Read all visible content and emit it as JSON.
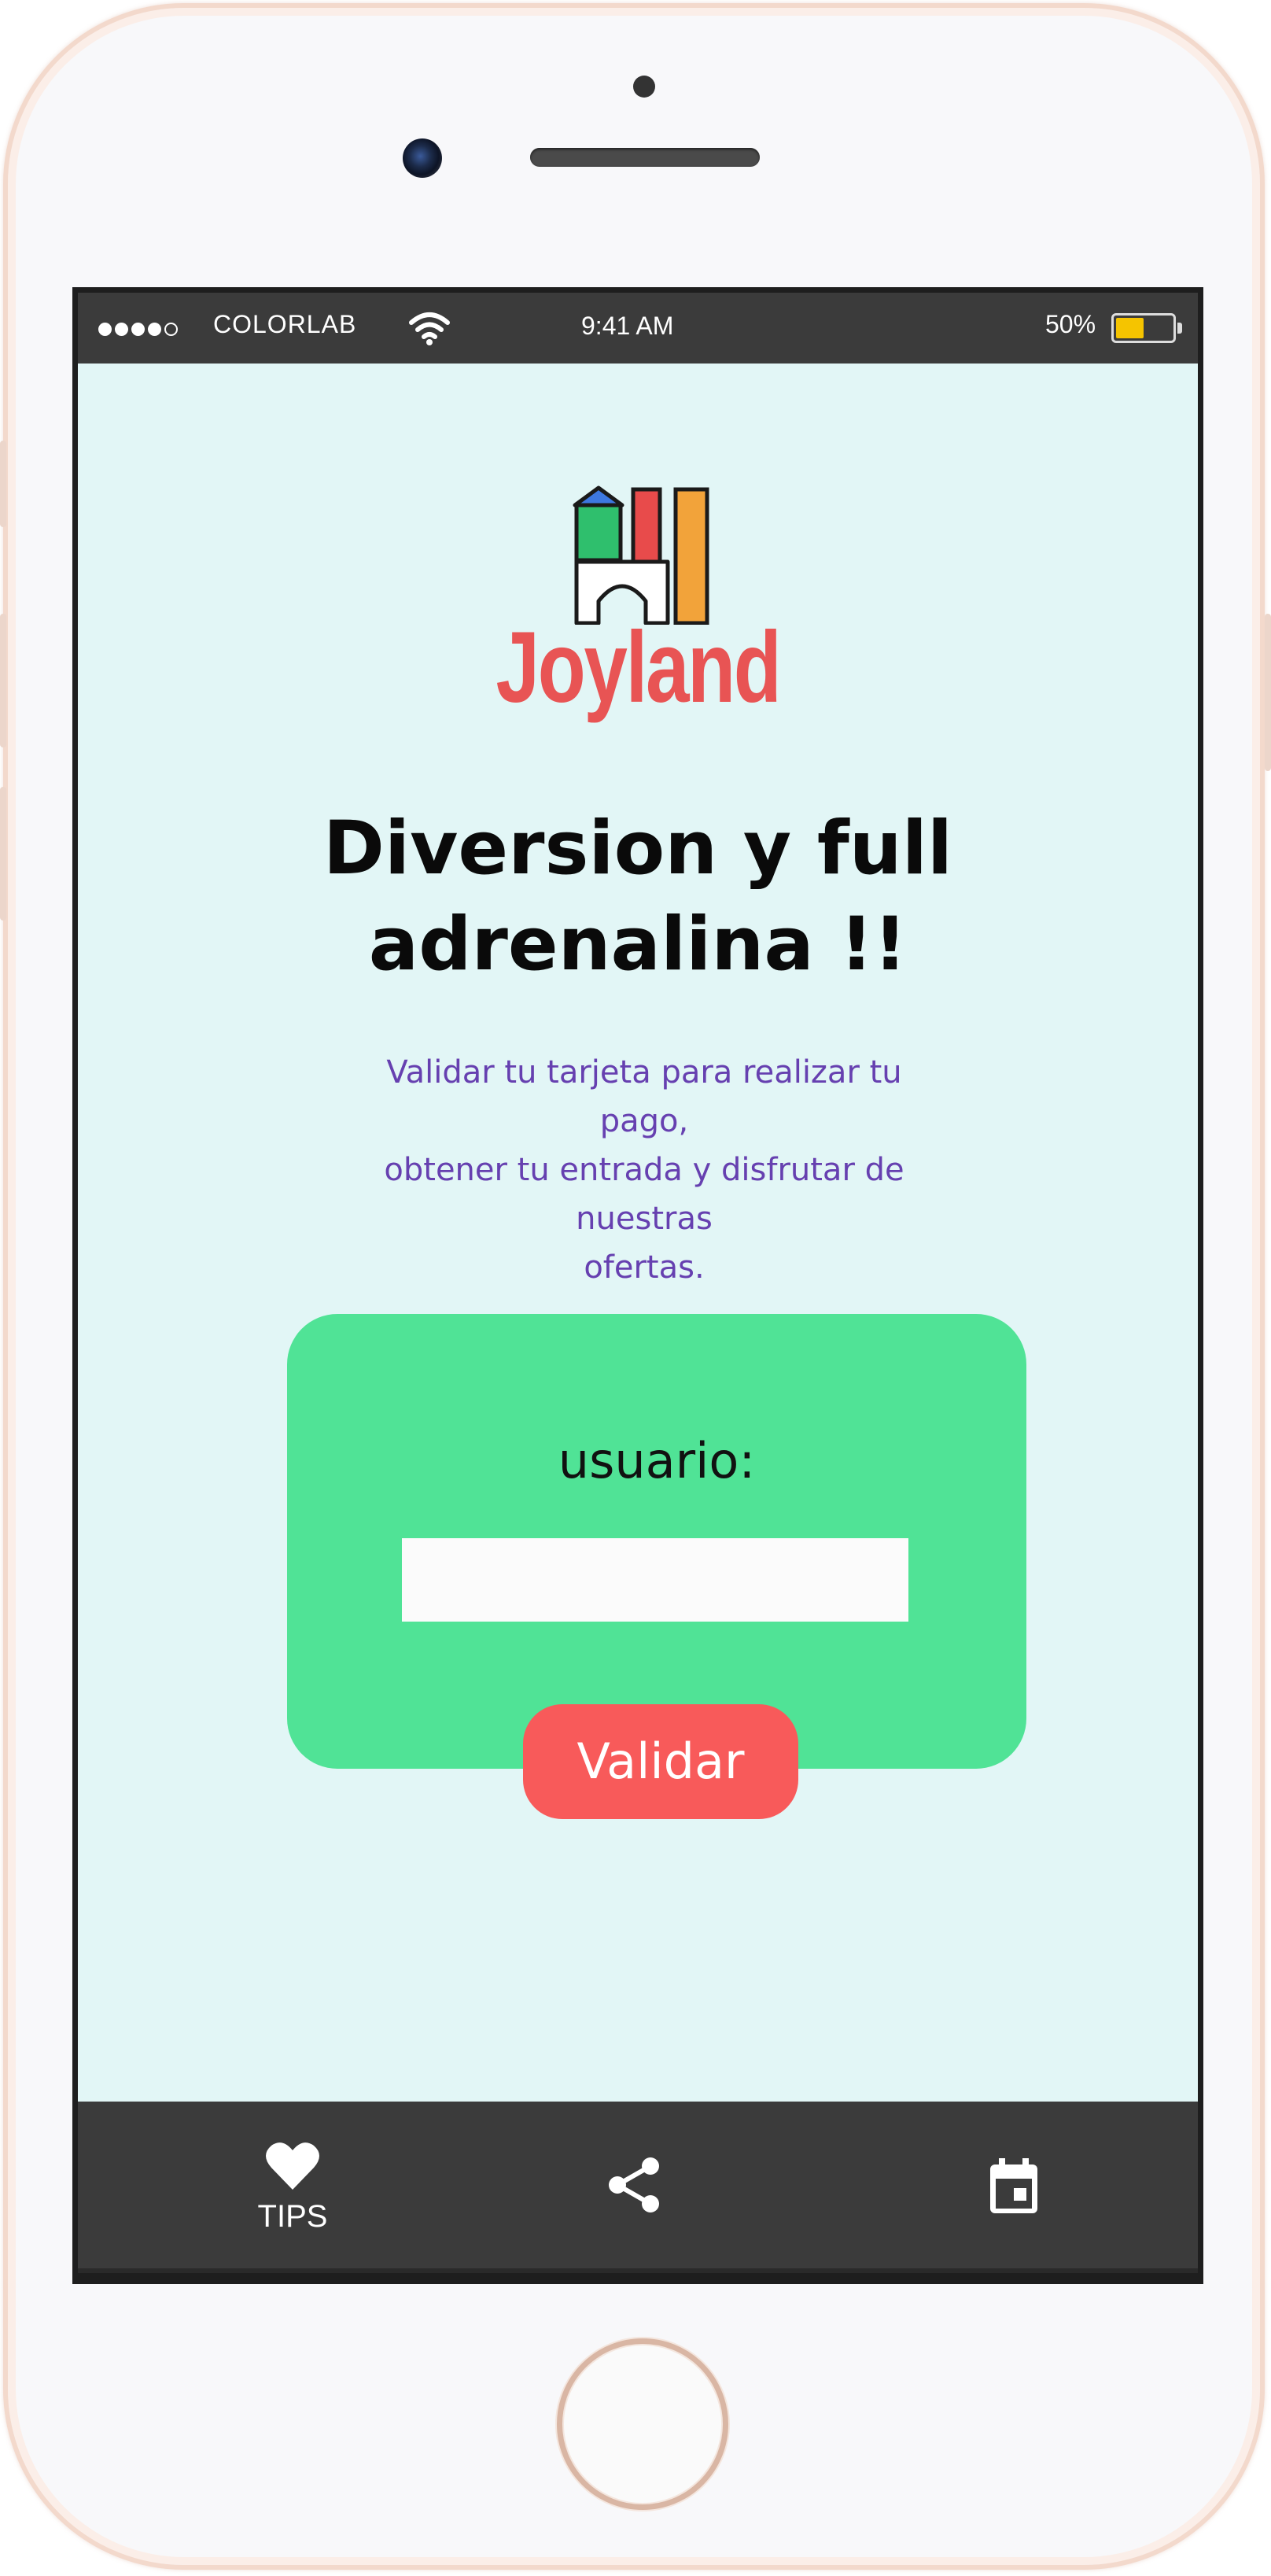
{
  "status_bar": {
    "carrier": "COLORLAB",
    "time": "9:41 AM",
    "battery_percent_label": "50%",
    "battery_level": 0.5,
    "signal_bars_filled": 4,
    "signal_bars_total": 5
  },
  "app": {
    "logo_text": "Joyland",
    "headline_line1": "Diversion y full",
    "headline_line2": "adrenalina !!",
    "subtitle_line1": "Validar tu tarjeta para realizar tu pago,",
    "subtitle_line2": "obtener tu entrada y disfrutar de nuestras",
    "subtitle_line3": "ofertas."
  },
  "form": {
    "user_label": "usuario:",
    "user_value": "",
    "validate_label": "Validar"
  },
  "tab_bar": {
    "tips_label": "TIPS",
    "icons": [
      "heart-icon",
      "share-icon",
      "calendar-icon"
    ]
  },
  "colors": {
    "background": "#e2f6f6",
    "card": "#50e396",
    "button": "#f85a5a",
    "logo": "#e85454",
    "subtitle": "#6640b0",
    "bars": "#3b3b3b"
  }
}
